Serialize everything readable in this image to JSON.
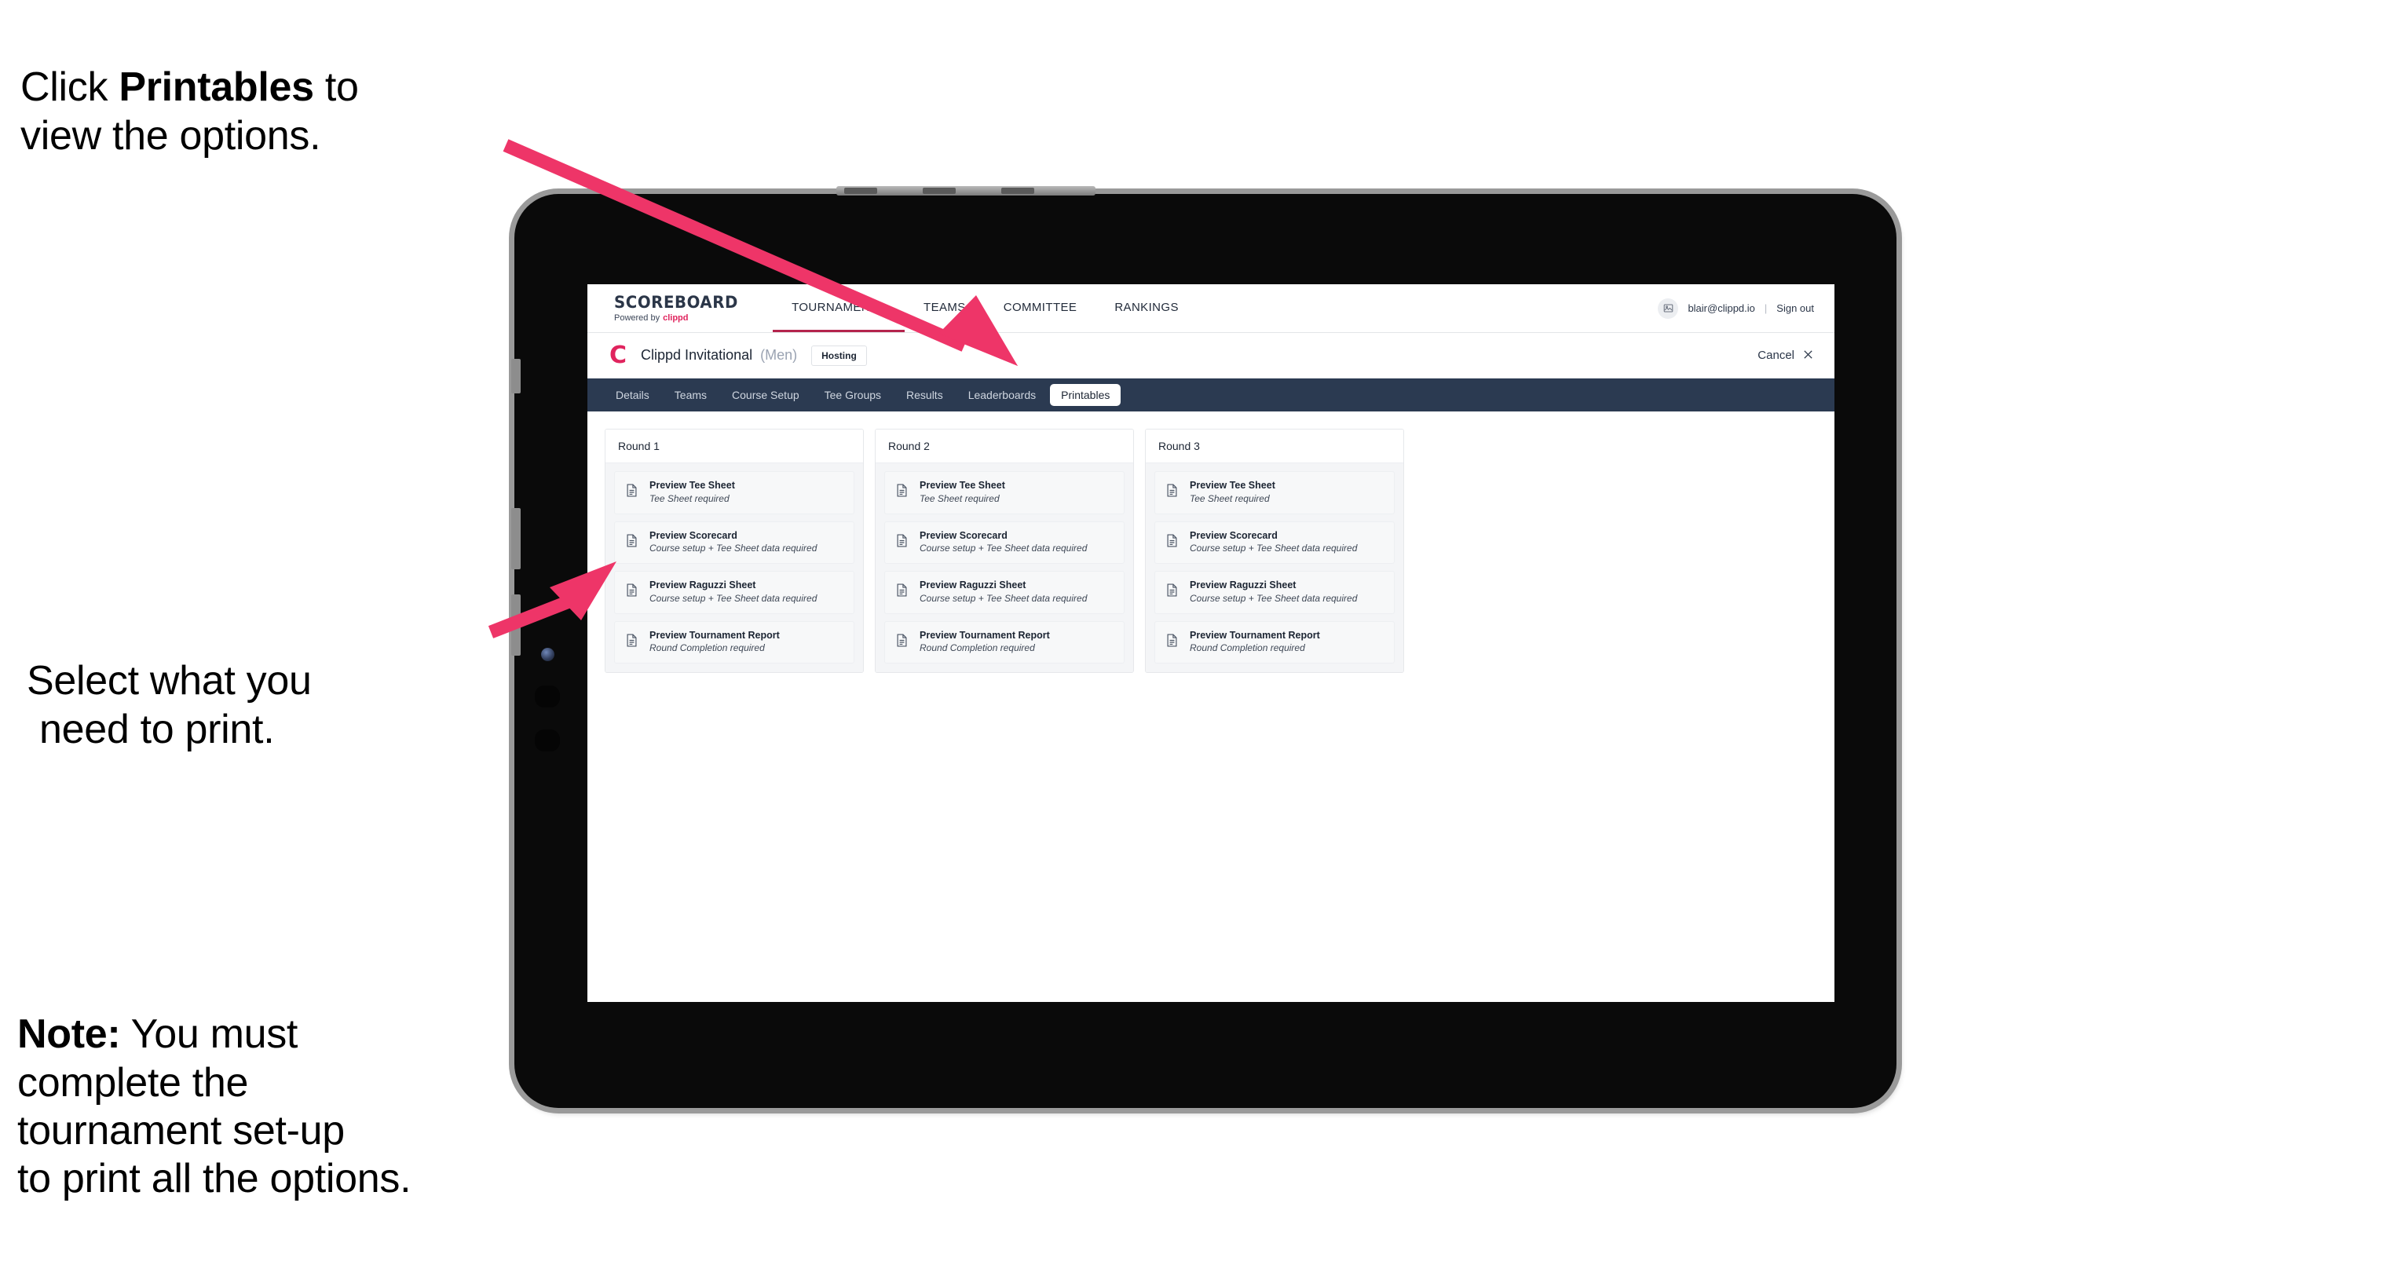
{
  "annotations": {
    "click_printables": {
      "prefix": "Click ",
      "bold": "Printables",
      "suffix": " to\nview the options."
    },
    "select_print_line1": "Select what you",
    "select_print_line2": "need to print.",
    "note": {
      "bold": "Note:",
      "rest": " You must\ncomplete the\ntournament set-up\nto print all the options."
    }
  },
  "colors": {
    "arrow": "#EE3568",
    "subnav_bg": "#2B3A51",
    "brand_accent": "#E0245E",
    "mainnav_active_underline": "#B4244C"
  },
  "app": {
    "brand": {
      "name": "SCOREBOARD",
      "powered_prefix": "Powered by",
      "powered_brand": "clippd"
    },
    "main_nav": [
      {
        "label": "TOURNAMENTS",
        "active": true
      },
      {
        "label": "TEAMS",
        "active": false
      },
      {
        "label": "COMMITTEE",
        "active": false
      },
      {
        "label": "RANKINGS",
        "active": false
      }
    ],
    "account": {
      "avatar_icon": "user-image-icon",
      "email": "blair@clippd.io",
      "separator": "|",
      "sign_out": "Sign out"
    },
    "tournament": {
      "logo_mark": "C",
      "title": "Clippd Invitational",
      "gender": "(Men)",
      "status_badge": "Hosting",
      "cancel_label": "Cancel",
      "cancel_icon": "close-icon"
    },
    "sub_nav": [
      {
        "label": "Details",
        "active": false
      },
      {
        "label": "Teams",
        "active": false
      },
      {
        "label": "Course Setup",
        "active": false
      },
      {
        "label": "Tee Groups",
        "active": false
      },
      {
        "label": "Results",
        "active": false
      },
      {
        "label": "Leaderboards",
        "active": false
      },
      {
        "label": "Printables",
        "active": true
      }
    ],
    "printables": {
      "rounds": [
        {
          "header": "Round 1",
          "items": [
            {
              "title": "Preview Tee Sheet",
              "requirement": "Tee Sheet required"
            },
            {
              "title": "Preview Scorecard",
              "requirement": "Course setup + Tee Sheet data required"
            },
            {
              "title": "Preview Raguzzi Sheet",
              "requirement": "Course setup + Tee Sheet data required"
            },
            {
              "title": "Preview Tournament Report",
              "requirement": "Round Completion required"
            }
          ]
        },
        {
          "header": "Round 2",
          "items": [
            {
              "title": "Preview Tee Sheet",
              "requirement": "Tee Sheet required"
            },
            {
              "title": "Preview Scorecard",
              "requirement": "Course setup + Tee Sheet data required"
            },
            {
              "title": "Preview Raguzzi Sheet",
              "requirement": "Course setup + Tee Sheet data required"
            },
            {
              "title": "Preview Tournament Report",
              "requirement": "Round Completion required"
            }
          ]
        },
        {
          "header": "Round 3",
          "items": [
            {
              "title": "Preview Tee Sheet",
              "requirement": "Tee Sheet required"
            },
            {
              "title": "Preview Scorecard",
              "requirement": "Course setup + Tee Sheet data required"
            },
            {
              "title": "Preview Raguzzi Sheet",
              "requirement": "Course setup + Tee Sheet data required"
            },
            {
              "title": "Preview Tournament Report",
              "requirement": "Round Completion required"
            }
          ]
        }
      ]
    }
  }
}
